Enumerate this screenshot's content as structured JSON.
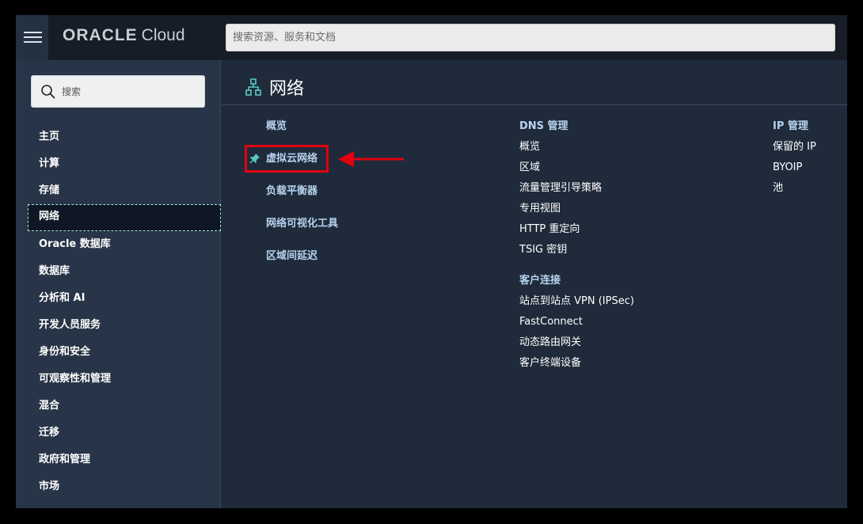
{
  "brand": {
    "oracle": "ORACLE",
    "cloud": "Cloud"
  },
  "search": {
    "placeholder": "搜索资源、服务和文档"
  },
  "sidebar": {
    "search_placeholder": "搜索",
    "items": [
      {
        "label": "主页"
      },
      {
        "label": "计算"
      },
      {
        "label": "存储"
      },
      {
        "label": "网络",
        "active": true
      },
      {
        "label": "Oracle 数据库"
      },
      {
        "label": "数据库"
      },
      {
        "label": "分析和 AI"
      },
      {
        "label": "开发人员服务"
      },
      {
        "label": "身份和安全"
      },
      {
        "label": "可观察性和管理"
      },
      {
        "label": "混合"
      },
      {
        "label": "迁移"
      },
      {
        "label": "政府和管理"
      },
      {
        "label": "市场"
      }
    ]
  },
  "page": {
    "title": "网络",
    "icon": "network-icon"
  },
  "columns": {
    "col1": {
      "items": [
        {
          "label": "概览"
        },
        {
          "label": "虚拟云网络",
          "pinned": true,
          "highlighted": true
        },
        {
          "label": "负载平衡器"
        },
        {
          "label": "网络可视化工具"
        },
        {
          "label": "区域间延迟"
        }
      ]
    },
    "col2": {
      "sections": [
        {
          "title": "DNS 管理",
          "items": [
            "概览",
            "区域",
            "流量管理引导策略",
            "专用视图",
            "HTTP 重定向",
            "TSIG 密钥"
          ]
        },
        {
          "title": "客户连接",
          "items": [
            "站点到站点 VPN (IPSec)",
            "FastConnect",
            "动态路由网关",
            "客户终端设备"
          ]
        }
      ]
    },
    "col3": {
      "sections": [
        {
          "title": "IP 管理",
          "items": [
            "保留的 IP",
            "BYOIP",
            "池"
          ]
        }
      ]
    }
  },
  "colors": {
    "background": "#1f2b3b",
    "topbar": "#161d27",
    "sidebar": "#283548",
    "link": "#b7d3ee",
    "accent": "#5bc8c2",
    "highlight": "#e3000e"
  }
}
